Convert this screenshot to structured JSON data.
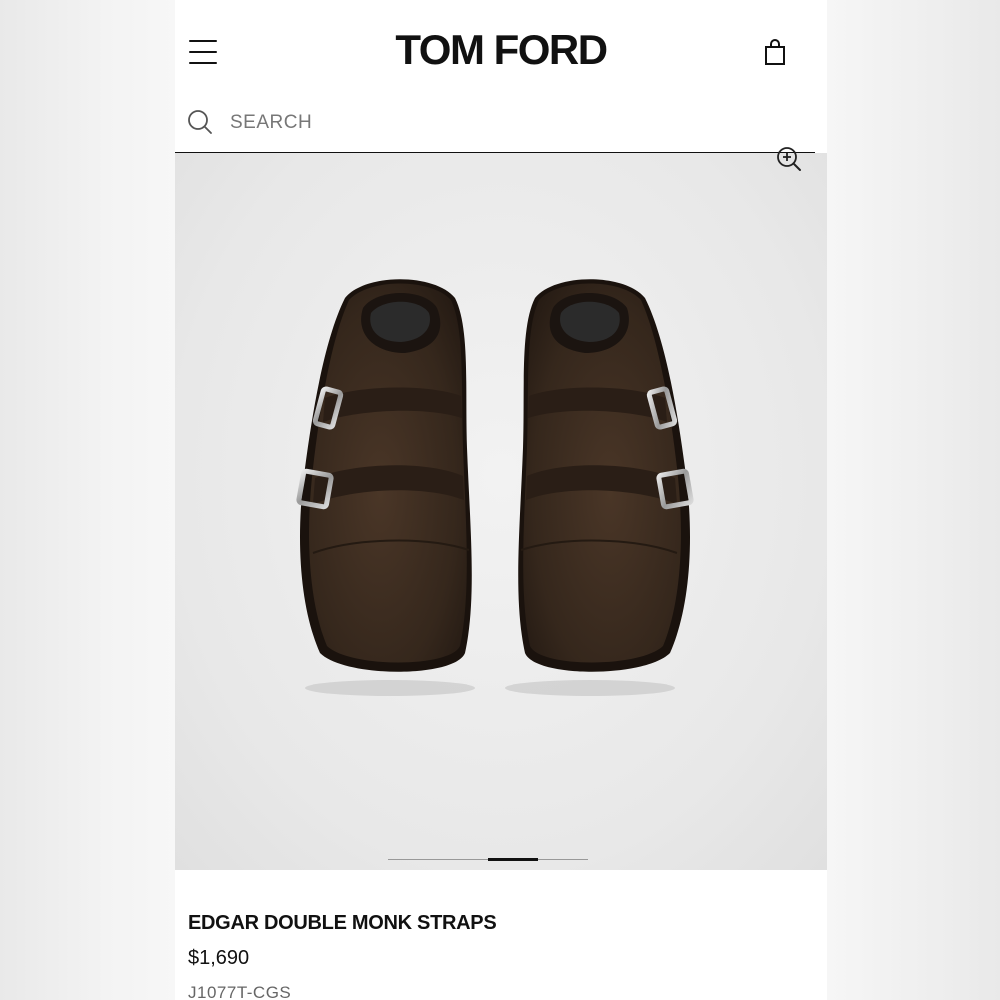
{
  "header": {
    "brand": "TOM FORD",
    "menu_icon": "hamburger-menu-icon",
    "bag_icon": "shopping-bag-icon"
  },
  "search": {
    "placeholder": "SEARCH",
    "icon": "search-icon"
  },
  "gallery": {
    "zoom_icon": "zoom-in-icon",
    "image_alt": "Dark brown suede double monk strap shoes",
    "slide_count": 4,
    "active_slide": 3
  },
  "product": {
    "name": "EDGAR DOUBLE MONK STRAPS",
    "price": "$1,690",
    "sku": "J1077T-CGS"
  },
  "colors": {
    "text": "#111111",
    "suede": "#3a2a1f",
    "gallery_bg": "#e8e8e8"
  }
}
